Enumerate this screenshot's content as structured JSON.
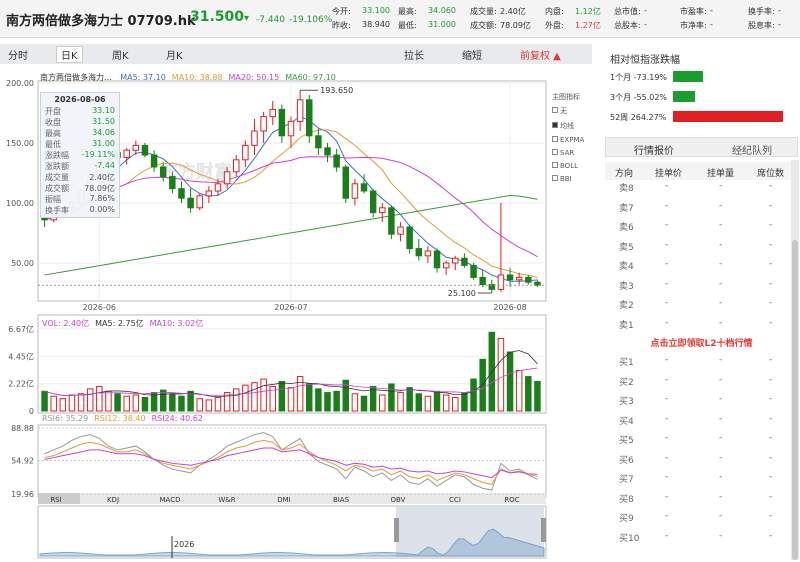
{
  "header": {
    "stock_name": "南方两倍做多海力士",
    "code": "07709.hk",
    "price": "31.500",
    "arrow": "▾",
    "change": "-7.440",
    "change_pct": "-19.106%",
    "fields": [
      {
        "label": "今开:",
        "value": "33.100",
        "color": "#1a9d2e"
      },
      {
        "label": "昨收:",
        "value": "38.940",
        "color": "#333333"
      },
      {
        "label": "最高:",
        "value": "34.060",
        "color": "#1a9d2e"
      },
      {
        "label": "最低:",
        "value": "31.000",
        "color": "#1a9d2e"
      },
      {
        "label": "成交量:",
        "value": "2.40亿",
        "color": "#333333"
      },
      {
        "label": "成交额:",
        "value": "78.09亿",
        "color": "#333333"
      },
      {
        "label": "内盘:",
        "value": "1.12亿",
        "color": "#1a9d2e"
      },
      {
        "label": "外盘:",
        "value": "1.27亿",
        "color": "#e53935"
      },
      {
        "label": "总市值:",
        "value": "-",
        "color": "#333333"
      },
      {
        "label": "总股本:",
        "value": "-",
        "color": "#333333"
      },
      {
        "label": "市盈率:",
        "value": "-",
        "color": "#333333"
      },
      {
        "label": "市净率:",
        "value": "-",
        "color": "#333333"
      },
      {
        "label": "换手率:",
        "value": "-",
        "color": "#333333"
      },
      {
        "label": "股息率:",
        "value": "-",
        "color": "#333333"
      }
    ]
  },
  "toolbar": {
    "periods": [
      "分时",
      "日K",
      "周K",
      "月K"
    ],
    "active": "日K",
    "actions": [
      "拉长",
      "缩短",
      "前复权 ▲"
    ]
  },
  "chart_info": {
    "name_short": "南方两倍做多海力...",
    "ma": [
      {
        "label": "MA5: 37.10",
        "color": "#3a6fd8"
      },
      {
        "label": "MA10: 38.88",
        "color": "#e59a2e"
      },
      {
        "label": "MA20: 50.15",
        "color": "#d13fd1"
      },
      {
        "label": "MA60: 97.10",
        "color": "#3a9a3a"
      }
    ],
    "y_ticks": [
      "200.00",
      "150.00",
      "100.00",
      "50.00"
    ],
    "x_ticks": [
      "2026-06",
      "2026-07",
      "2026-08"
    ],
    "high_label": "193.650",
    "low_label": "25.100",
    "watermark": "东方财富"
  },
  "tooltip": {
    "date": "2026-08-06",
    "rows": [
      {
        "label": "开盘",
        "value": "33.10",
        "color": "#1a9d2e"
      },
      {
        "label": "收盘",
        "value": "31.50",
        "color": "#1a9d2e"
      },
      {
        "label": "最高",
        "value": "34.06",
        "color": "#1a9d2e"
      },
      {
        "label": "最低",
        "value": "31.00",
        "color": "#1a9d2e"
      },
      {
        "label": "涨跌幅",
        "value": "-19.11%",
        "color": "#1a9d2e"
      },
      {
        "label": "涨跌额",
        "value": "-7.44",
        "color": "#1a9d2e"
      },
      {
        "label": "成交量",
        "value": "2.40亿",
        "color": "#555555"
      },
      {
        "label": "成交额",
        "value": "78.09亿",
        "color": "#555555"
      },
      {
        "label": "振幅",
        "value": "7.86%",
        "color": "#555555"
      },
      {
        "label": "换手率",
        "value": "0.00%",
        "color": "#555555"
      }
    ]
  },
  "indicator_panel": {
    "title": "主图指标",
    "options": [
      "无",
      "均线",
      "EXPMA",
      "SAR",
      "BOLL",
      "BBI"
    ],
    "selected": "均线"
  },
  "volume": {
    "labels": [
      {
        "label": "VOL: 2.40亿",
        "color": "#d13fd1"
      },
      {
        "label": "MA5: 2.75亿",
        "color": "#333333"
      },
      {
        "label": "MA10: 3.02亿",
        "color": "#d13fd1"
      }
    ],
    "y_ticks": [
      "6.67亿",
      "4.45亿",
      "2.22亿",
      "0"
    ]
  },
  "rsi": {
    "labels": [
      {
        "label": "RSI6: 35.29",
        "color": "#999999"
      },
      {
        "label": "RSI12: 38.40",
        "color": "#e59a2e"
      },
      {
        "label": "RSI24: 40.62",
        "color": "#d13fd1"
      }
    ],
    "y_ticks": [
      "88.88",
      "54.92",
      "19.96"
    ]
  },
  "indicator_tabs": [
    "RSI",
    "KDJ",
    "MACD",
    "W&R",
    "DMI",
    "BIAS",
    "OBV",
    "CCI",
    "ROC"
  ],
  "navigator": {
    "year_label": "2026"
  },
  "perf": {
    "title": "相对恒指涨跌幅",
    "rows": [
      {
        "label": "1个月 -73.19%",
        "color": "#1a9d2e"
      },
      {
        "label": "3个月 -55.02%",
        "color": "#1a9d2e"
      },
      {
        "label": "52周 264.27%",
        "color": "#e02020"
      }
    ]
  },
  "orderbook": {
    "tabs": [
      "行情报价",
      "经纪队列"
    ],
    "headers": [
      "方向",
      "挂单价",
      "挂单量",
      "席位数"
    ],
    "sells": [
      "卖8",
      "卖7",
      "卖6",
      "卖5",
      "卖4",
      "卖3",
      "卖2",
      "卖1"
    ],
    "notice": "点击立即领取L2十档行情",
    "buys": [
      "买1",
      "买2",
      "买3",
      "买4",
      "买5",
      "买6",
      "买7",
      "买8",
      "买9",
      "买10"
    ],
    "placeholder": "-"
  },
  "chart_data": {
    "type": "candlestick",
    "x_axis": [
      "2026-06",
      "2026-07",
      "2026-08"
    ],
    "ylim": [
      20,
      200
    ],
    "candles": [
      [
        88,
        95,
        80,
        86
      ],
      [
        86,
        92,
        84,
        90
      ],
      [
        90,
        96,
        88,
        94
      ],
      [
        96,
        104,
        92,
        100
      ],
      [
        100,
        112,
        96,
        110
      ],
      [
        110,
        126,
        106,
        120
      ],
      [
        120,
        140,
        112,
        136
      ],
      [
        136,
        148,
        130,
        142
      ],
      [
        142,
        150,
        134,
        138
      ],
      [
        138,
        146,
        132,
        144
      ],
      [
        144,
        152,
        140,
        148
      ],
      [
        148,
        150,
        138,
        140
      ],
      [
        140,
        144,
        126,
        130
      ],
      [
        130,
        134,
        118,
        122
      ],
      [
        122,
        126,
        108,
        112
      ],
      [
        112,
        118,
        100,
        104
      ],
      [
        104,
        112,
        92,
        96
      ],
      [
        96,
        108,
        94,
        106
      ],
      [
        106,
        114,
        100,
        110
      ],
      [
        110,
        120,
        106,
        116
      ],
      [
        116,
        130,
        112,
        126
      ],
      [
        126,
        140,
        122,
        136
      ],
      [
        136,
        152,
        130,
        148
      ],
      [
        148,
        170,
        140,
        160
      ],
      [
        160,
        176,
        150,
        172
      ],
      [
        172,
        185,
        165,
        178
      ],
      [
        178,
        182,
        150,
        156
      ],
      [
        156,
        172,
        146,
        168
      ],
      [
        168,
        194,
        160,
        186
      ],
      [
        186,
        190,
        150,
        156
      ],
      [
        156,
        162,
        140,
        146
      ],
      [
        146,
        150,
        134,
        140
      ],
      [
        140,
        145,
        126,
        130
      ],
      [
        130,
        132,
        100,
        104
      ],
      [
        104,
        120,
        98,
        116
      ],
      [
        116,
        124,
        108,
        110
      ],
      [
        110,
        112,
        88,
        92
      ],
      [
        92,
        100,
        84,
        96
      ],
      [
        96,
        98,
        70,
        74
      ],
      [
        74,
        84,
        68,
        80
      ],
      [
        80,
        82,
        58,
        62
      ],
      [
        62,
        70,
        52,
        56
      ],
      [
        56,
        64,
        50,
        60
      ],
      [
        60,
        62,
        42,
        46
      ],
      [
        46,
        52,
        40,
        50
      ],
      [
        50,
        56,
        44,
        54
      ],
      [
        54,
        58,
        46,
        48
      ],
      [
        48,
        50,
        36,
        38
      ],
      [
        38,
        44,
        30,
        32
      ],
      [
        32,
        36,
        25,
        28
      ],
      [
        28,
        100,
        26,
        40
      ],
      [
        40,
        46,
        30,
        36
      ],
      [
        36,
        42,
        32,
        38
      ],
      [
        38,
        40,
        32,
        34
      ],
      [
        34,
        36,
        30,
        31.5
      ]
    ],
    "volumes": [
      1.6,
      1.2,
      1.0,
      1.3,
      1.4,
      1.8,
      2.0,
      1.6,
      1.4,
      1.2,
      1.3,
      1.1,
      1.5,
      1.7,
      1.4,
      1.2,
      1.6,
      1.0,
      0.9,
      1.1,
      1.5,
      1.8,
      2.1,
      2.3,
      2.6,
      2.0,
      2.4,
      1.9,
      2.8,
      2.2,
      1.8,
      1.5,
      1.6,
      2.5,
      1.4,
      1.2,
      2.0,
      1.3,
      2.2,
      1.5,
      1.9,
      1.4,
      1.2,
      1.6,
      1.3,
      1.1,
      1.5,
      2.6,
      4.2,
      6.4,
      5.9,
      4.8,
      3.3,
      2.8,
      2.4
    ],
    "rsi6": [
      62,
      66,
      70,
      76,
      80,
      82,
      78,
      70,
      66,
      68,
      70,
      64,
      56,
      50,
      46,
      44,
      42,
      50,
      56,
      62,
      70,
      74,
      78,
      82,
      84,
      80,
      66,
      72,
      78,
      62,
      54,
      50,
      46,
      36,
      48,
      44,
      38,
      42,
      34,
      40,
      32,
      30,
      36,
      28,
      34,
      40,
      38,
      30,
      26,
      24,
      52,
      44,
      46,
      40,
      35.29
    ],
    "rsi12": [
      58,
      60,
      64,
      68,
      72,
      74,
      72,
      68,
      64,
      64,
      66,
      62,
      56,
      52,
      50,
      48,
      46,
      50,
      54,
      58,
      64,
      68,
      70,
      74,
      76,
      74,
      66,
      68,
      72,
      64,
      58,
      54,
      50,
      44,
      50,
      48,
      44,
      46,
      40,
      44,
      38,
      36,
      40,
      34,
      38,
      42,
      40,
      36,
      32,
      30,
      46,
      42,
      44,
      40,
      38.4
    ],
    "rsi24": [
      56,
      58,
      60,
      62,
      64,
      66,
      66,
      64,
      62,
      62,
      62,
      60,
      56,
      54,
      52,
      51,
      50,
      52,
      54,
      56,
      60,
      62,
      64,
      66,
      68,
      68,
      64,
      65,
      66,
      62,
      58,
      56,
      54,
      50,
      52,
      51,
      48,
      49,
      46,
      47,
      44,
      43,
      44,
      41,
      42,
      44,
      43,
      41,
      39,
      37,
      45,
      42,
      43,
      41,
      40.62
    ]
  }
}
